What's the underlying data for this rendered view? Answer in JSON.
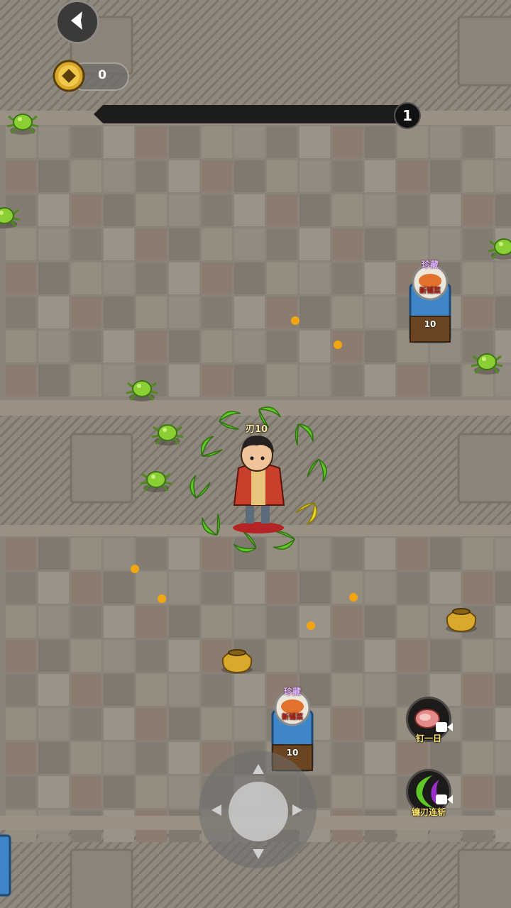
{
  "hud": {
    "coin_count": "0",
    "level": "1",
    "wave_progress": 0
  },
  "hero": {
    "label": "刃10"
  },
  "chests": [
    {
      "badge": "珍藏",
      "name": "新铺菜",
      "count": "10"
    },
    {
      "badge": "珍藏",
      "name": "新铺菜",
      "count": "10"
    }
  ],
  "skills": [
    {
      "icon": "meat-icon",
      "caption": "钉一日"
    },
    {
      "icon": "crescent-blade-icon",
      "caption": "镰刃连斩"
    }
  ],
  "icons": {
    "back": "back-arrow-icon",
    "coin": "coin-icon",
    "video": "video-ad-icon"
  },
  "colors": {
    "blade_green": "#5dc826",
    "blade_yellow": "#e8d422",
    "pickup_orange": "#f2a511",
    "chest_blue": "#3f86c9",
    "spider_green": "#8ad035"
  }
}
